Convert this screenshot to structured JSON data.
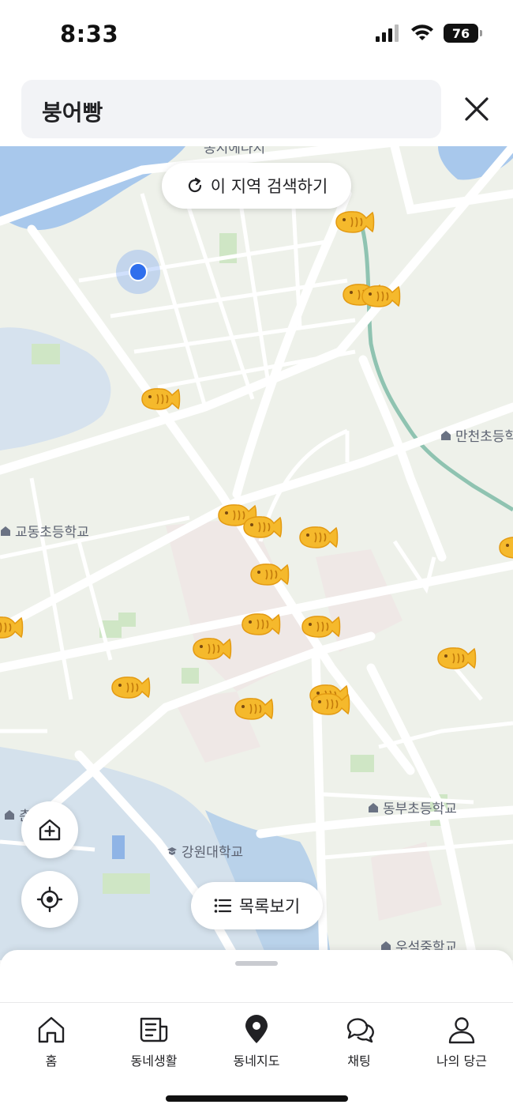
{
  "status_bar": {
    "time": "8:33",
    "battery": "76"
  },
  "search": {
    "query": "붕어빵"
  },
  "map": {
    "search_area_label": "이 지역 검색하기",
    "list_view_label": "목록보기",
    "places": {
      "top_partial": "봉지에나지",
      "gyodong": "교동초등학교",
      "mancheon": "만천초등학",
      "kangwon_univ": "강원대학교",
      "dongbu": "동부초등학교",
      "left_school": "춘 등학교",
      "useok": "우석중학교"
    }
  },
  "tabs": [
    {
      "label": "홈",
      "icon": "home-icon"
    },
    {
      "label": "동네생활",
      "icon": "newspaper-icon"
    },
    {
      "label": "동네지도",
      "icon": "map-pin-icon"
    },
    {
      "label": "채팅",
      "icon": "chat-icon"
    },
    {
      "label": "나의 당근",
      "icon": "person-icon"
    }
  ],
  "colors": {
    "water": "#a8c8ec",
    "park": "#cfe6c5",
    "map_bg": "#eef1ea",
    "fish": "#f5b92c",
    "location": "#2f6fed"
  }
}
